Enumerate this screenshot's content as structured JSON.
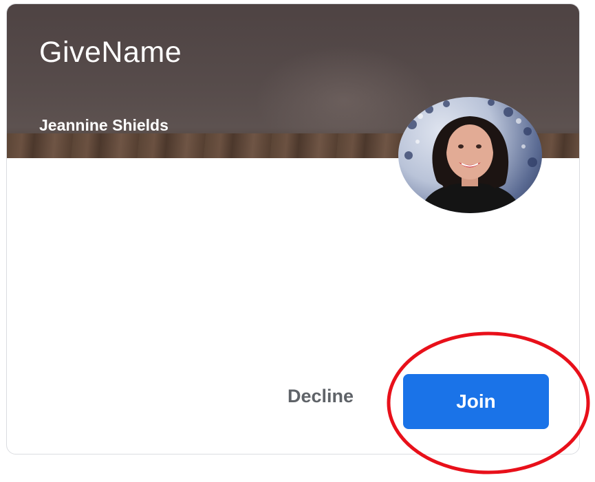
{
  "class_card": {
    "title": "GiveName",
    "teacher": "Jeannine Shields",
    "header_color": "#574c4b",
    "avatar_icon": "teacher-avatar"
  },
  "actions": {
    "decline_label": "Decline",
    "join_label": "Join",
    "join_color": "#1a73e8",
    "decline_color": "#5f6368"
  },
  "annotation": {
    "shape": "ellipse",
    "color": "#e8101a",
    "target": "join"
  }
}
